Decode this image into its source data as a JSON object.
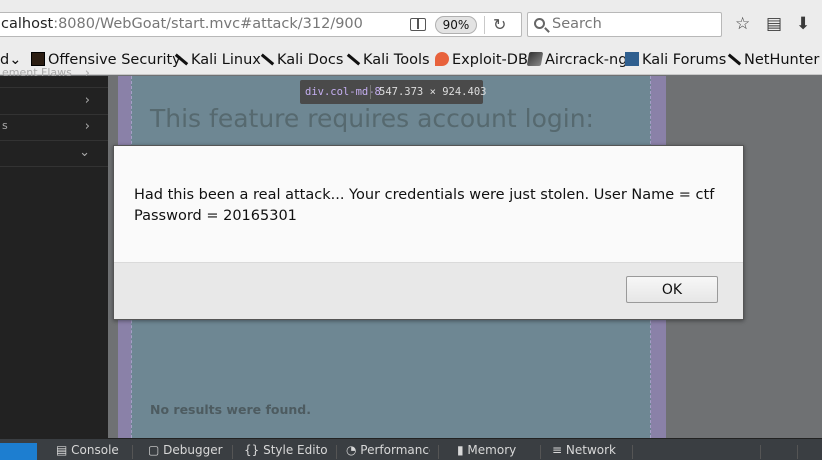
{
  "browser": {
    "url_host": "calhost",
    "url_rest": ":8080/WebGoat/start.mvc#attack/312/900",
    "zoom": "90%",
    "search_placeholder": "Search",
    "bookmarks_menu_fragment": "d",
    "bookmarks": [
      {
        "label": "Offensive Security",
        "icon": "offsec-icon"
      },
      {
        "label": "Kali Linux",
        "icon": "kali-dragon-icon"
      },
      {
        "label": "Kali Docs",
        "icon": "kali-dragon-icon"
      },
      {
        "label": "Kali Tools",
        "icon": "kali-dragon-icon"
      },
      {
        "label": "Exploit-DB",
        "icon": "exploit-db-icon"
      },
      {
        "label": "Aircrack-ng",
        "icon": "aircrack-icon"
      },
      {
        "label": "Kali Forums",
        "icon": "kali-forums-icon"
      },
      {
        "label": "NetHunter",
        "icon": "kali-dragon-icon"
      }
    ]
  },
  "sidebar": {
    "items": [
      {
        "label": "ement Flaws"
      },
      {
        "label": ""
      },
      {
        "label": "s"
      },
      {
        "label": ""
      }
    ]
  },
  "content": {
    "heading": "This feature requires account login:",
    "no_results": "No results were found."
  },
  "inspector": {
    "selector": "div.col-md-8",
    "dimensions": "547.373 × 924.403"
  },
  "dialog": {
    "message": "Had this been a real attack... Your credentials were just stolen. User Name = ctf Password = 20165301",
    "ok_label": "OK"
  },
  "devtools": {
    "tabs": [
      "",
      "Console",
      "Debugger",
      "Style Editor",
      "Performance",
      "Memory",
      "Network"
    ]
  },
  "colors": {
    "devtools_active_tab": "#1d7ed0",
    "content_highlight": "#8a81a8"
  }
}
